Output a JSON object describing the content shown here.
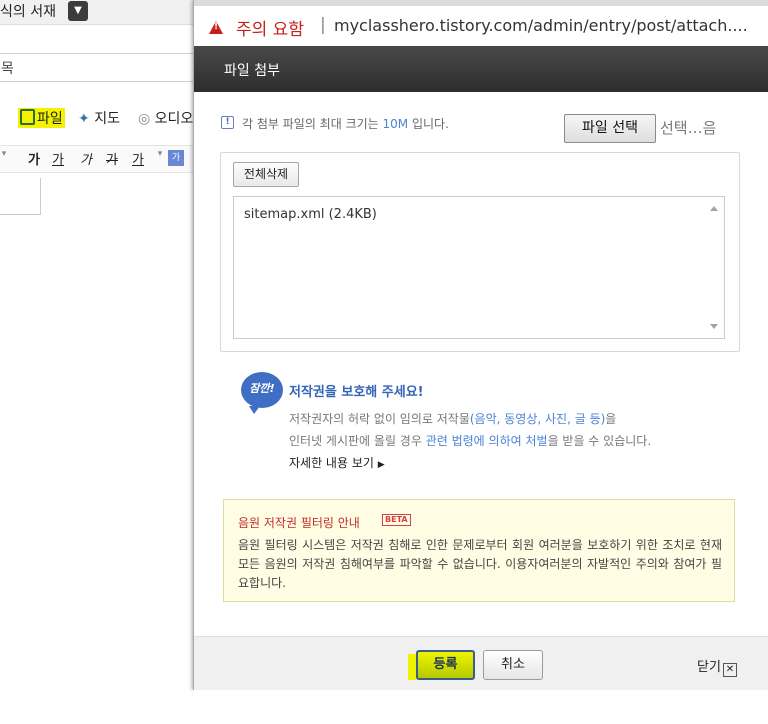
{
  "background": {
    "blog_title": "식의 서재",
    "title_field_value": "목",
    "toolbar": {
      "file_label": "파일",
      "map_label": "지도",
      "audio_label": "오디오"
    },
    "format_buttons": [
      "가",
      "가",
      "가",
      "가",
      "가",
      "가"
    ]
  },
  "browser": {
    "security_warning": "주의 요함",
    "separator": "|",
    "url": "myclasshero.tistory.com/admin/entry/post/attach...."
  },
  "dialog": {
    "title": "파일 첨부",
    "info": {
      "prefix": "각 첨부 파일의 최대 크기는 ",
      "size": "10M",
      "suffix": " 입니다."
    },
    "choose_file_button": "파일 선택",
    "no_file_text": "선택…음",
    "delete_all_button": "전체삭제",
    "files": [
      "sitemap.xml (2.4KB)"
    ],
    "copyright": {
      "icon_text": "잠깐!",
      "title": "저작권을 보호해 주세요!",
      "line1_prefix": "저작권자의 허락 없이 임의로 저작물",
      "line1_highlight": "(음악, 동영상, 사진, 글 등)",
      "line1_suffix": "을",
      "line2_prefix": "인터넷 게시판에 올릴 경우 ",
      "line2_highlight": "관련 법령에 의하여 처벌",
      "line2_suffix": "을 받을 수 있습니다.",
      "more_link": "자세한 내용 보기"
    },
    "music_filter": {
      "title": "음원 저작권 필터링 안내",
      "badge": "BETA",
      "body": "음원 필터링 시스템은 저작권 침해로 인한 문제로부터 회원 여러분을 보호하기 위한 조치로 현재 모든 음원의 저작권 침해여부를 파악할 수 없습니다. 이용자여러분의 자발적인 주의와 참여가 필요합니다."
    },
    "register_button": "등록",
    "cancel_button": "취소",
    "close_label": "닫기",
    "close_icon_glyph": "✕"
  },
  "colors": {
    "warning_red": "#c5221f",
    "header_dark": "#2d2d2d",
    "link_blue": "#4a83d6",
    "highlight_yellow": "#eef400",
    "notice_bg": "#fffde3"
  }
}
